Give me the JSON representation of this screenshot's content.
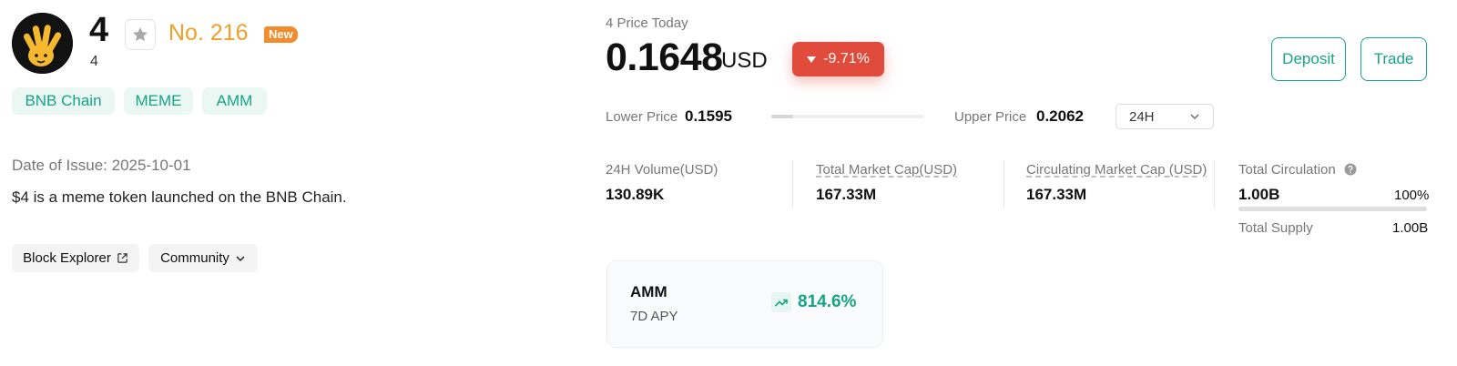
{
  "token": {
    "symbol": "4",
    "sub_symbol": "4",
    "rank": "No. 216",
    "new_badge": "New",
    "logo_icon": "yellow-hand-logo-icon",
    "favorite_icon": "star-icon"
  },
  "tags": [
    "BNB Chain",
    "MEME",
    "AMM"
  ],
  "info": {
    "issue_date": "Date of Issue: 2025-10-01",
    "description": "$4 is a meme token launched on the BNB Chain."
  },
  "links": {
    "block_explorer": "Block Explorer",
    "block_explorer_icon": "external-link-icon",
    "community": "Community",
    "community_icon": "chevron-down-icon"
  },
  "price": {
    "label": "4 Price Today",
    "value": "0.1648",
    "unit": "USD",
    "change": "-9.71%",
    "change_color": "#e04b3b",
    "change_icon": "triangle-down-icon"
  },
  "actions": {
    "deposit": "Deposit",
    "trade": "Trade",
    "accent": "#17a387"
  },
  "range": {
    "lower_label": "Lower Price",
    "lower_value": "0.1595",
    "upper_label": "Upper Price",
    "upper_value": "0.2062",
    "position_fraction": 0.14,
    "period": "24H",
    "period_icon": "chevron-down-icon"
  },
  "stats": [
    {
      "label": "24H Volume(USD)",
      "value": "130.89K"
    },
    {
      "label": "Total Market Cap(USD)",
      "value": "167.33M"
    },
    {
      "label": "Circulating Market Cap (USD)",
      "value": "167.33M"
    }
  ],
  "circulation": {
    "label": "Total Circulation",
    "label_icon": "question-circle-icon",
    "value": "1.00B",
    "percent": "100%",
    "fraction": 1.0,
    "supply_label": "Total Supply",
    "supply_value": "1.00B"
  },
  "amm": {
    "title": "AMM",
    "subtitle": "7D APY",
    "apy": "814.6%",
    "apy_icon": "trending-up-icon"
  }
}
